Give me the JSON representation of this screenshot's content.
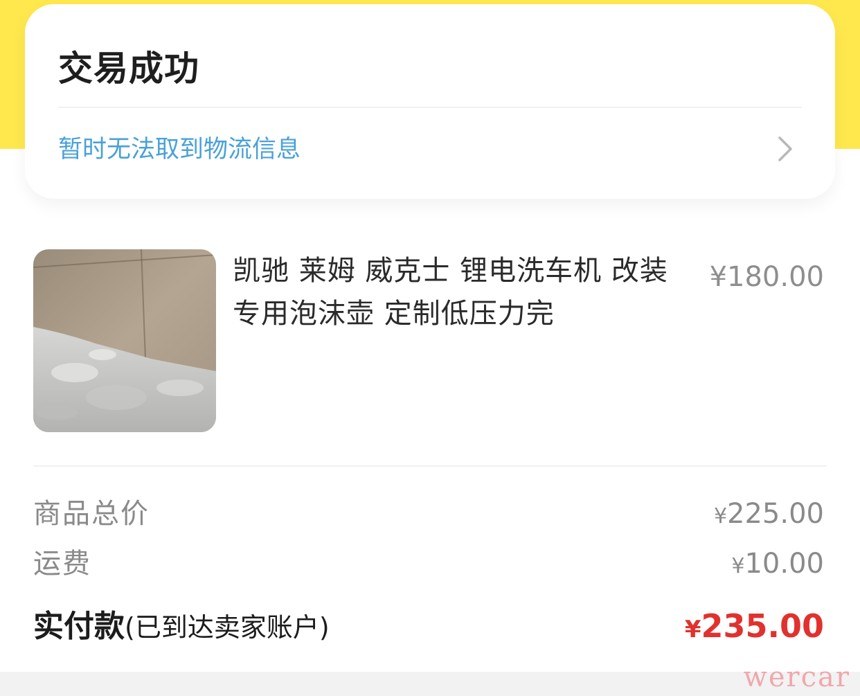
{
  "status_card": {
    "title": "交易成功",
    "logistics_text": "暂时无法取到物流信息"
  },
  "product": {
    "title": "凯驰 莱姆 威克士 锂电洗车机 改装专用泡沫壶 定制低压力完",
    "price": "¥180.00"
  },
  "summary": {
    "subtotal_label": "商品总价",
    "subtotal_currency": "¥",
    "subtotal_value": "225.00",
    "shipping_label": "运费",
    "shipping_currency": "¥",
    "shipping_value": "10.00",
    "paid_label": "实付款",
    "paid_note": "(已到达卖家账户)",
    "paid_currency": "¥",
    "paid_value": "235.00"
  },
  "watermark": "wercar",
  "colors": {
    "header_yellow": "#ffe84d",
    "link_blue": "#4aa1d8",
    "total_red": "#e1312e"
  }
}
